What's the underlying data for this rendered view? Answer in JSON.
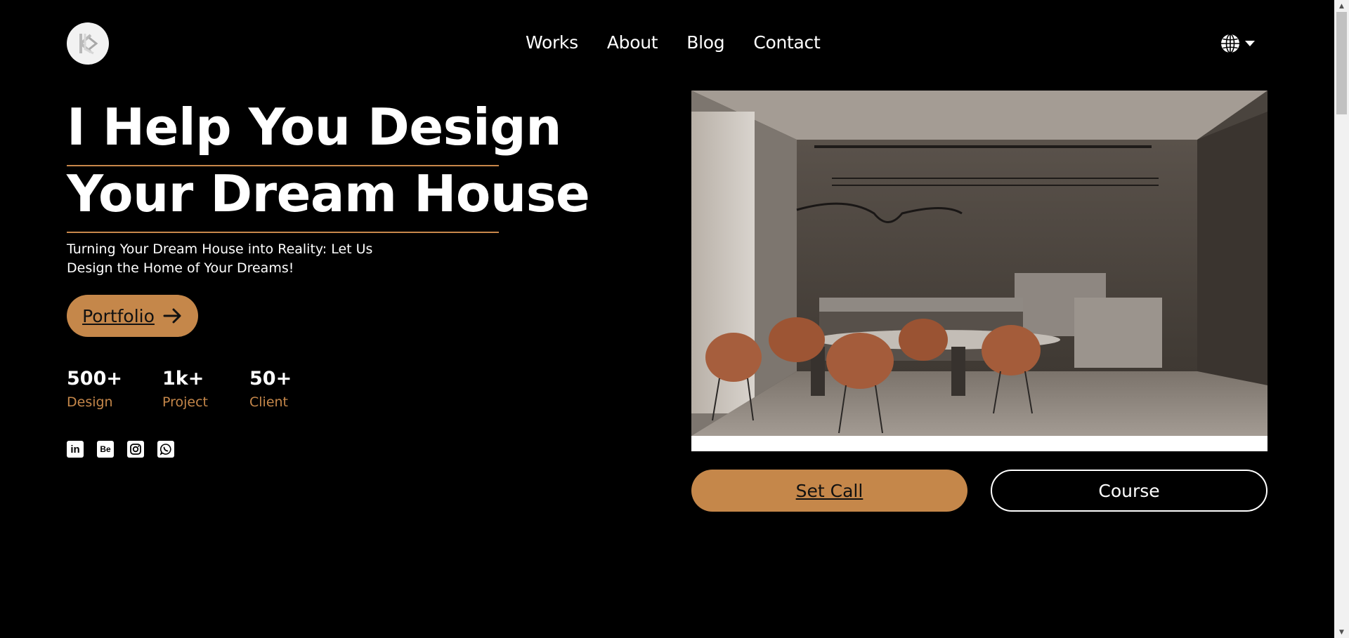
{
  "header": {
    "logo_icon": "monogram-logo-icon",
    "nav": [
      "Works",
      "About",
      "Blog",
      "Contact"
    ],
    "language_icon": "globe-icon"
  },
  "hero": {
    "title_line1": "I Help You Design",
    "title_line2": "Your Dream House",
    "subtitle_line1": "Turning Your Dream House into Reality: Let Us",
    "subtitle_line2": "Design the Home of Your Dreams!",
    "portfolio_label": "Portfolio",
    "stats": [
      {
        "value": "500+",
        "label": "Design"
      },
      {
        "value": "1k+",
        "label": "Project"
      },
      {
        "value": "50+",
        "label": "Client"
      }
    ],
    "socials": [
      "linkedin-icon",
      "behance-icon",
      "instagram-icon",
      "whatsapp-icon"
    ],
    "social_glyphs": {
      "linkedin": "in",
      "behance": "Be"
    }
  },
  "actions": {
    "set_call_label": "Set Call",
    "course_label": "Course"
  },
  "colors": {
    "accent": "#c5874a",
    "background": "#000000",
    "text": "#ffffff"
  }
}
